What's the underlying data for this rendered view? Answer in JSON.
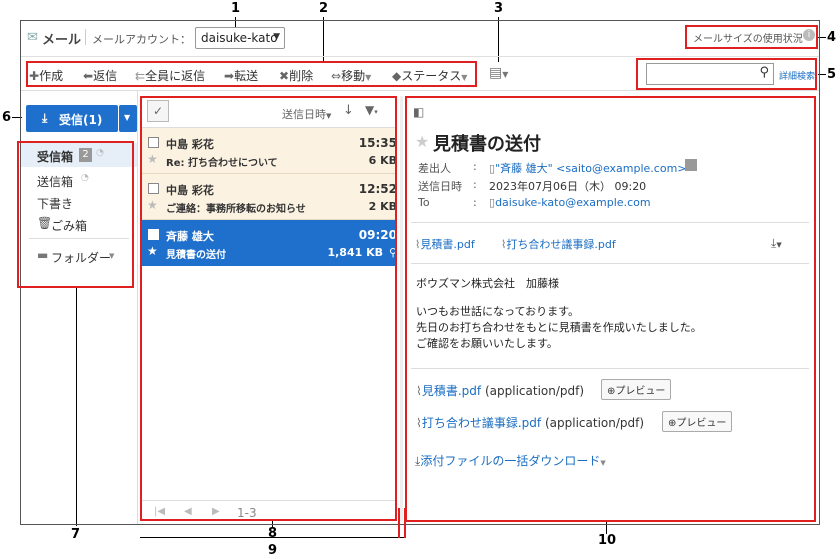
{
  "callouts": [
    "1",
    "2",
    "3",
    "4",
    "5",
    "6",
    "7",
    "8",
    "9",
    "10"
  ],
  "header": {
    "app_title": "メール",
    "account_label": "メールアカウント：",
    "account_value": "daisuke-kato",
    "mail_size_link": "メールサイズの使用状況"
  },
  "toolbar": {
    "compose": "作成",
    "reply": "返信",
    "reply_all": "全員に返信",
    "forward": "転送",
    "delete": "削除",
    "move": "移動",
    "status": "ステータス",
    "advanced_search": "詳細検索"
  },
  "receive_button": "受信(1)",
  "folders": {
    "inbox": "受信箱",
    "inbox_count": "2",
    "sent": "送信箱",
    "drafts": "下書き",
    "trash": "ごみ箱",
    "folder_menu": "フォルダー"
  },
  "list": {
    "sort_label": "送信日時",
    "pagination": "1-3",
    "rows": [
      {
        "sender": "中島 彩花",
        "subject": "Re: 打ち合わせについて",
        "time": "15:35",
        "size": "6 KB"
      },
      {
        "sender": "中島 彩花",
        "subject": "ご連絡：事務所移転のお知らせ",
        "time": "12:52",
        "size": "2 KB"
      },
      {
        "sender": "斉藤 雄大",
        "subject": "見積書の送付",
        "time": "09:20",
        "size": "1,841 KB"
      }
    ]
  },
  "message": {
    "subject": "見積書の送付",
    "from_label": "差出人",
    "from_value": "\"斉藤 雄大\" <saito@example.com>",
    "date_label": "送信日時",
    "date_value": "2023年07月06日（木） 09:20",
    "to_label": "To",
    "to_value": "daisuke-kato@example.com",
    "attach_top_1": "見積書.pdf",
    "attach_top_2": "打ち合わせ議事録.pdf",
    "body_line1": "ボウズマン株式会社　加藤様",
    "body_line2": "いつもお世話になっております。",
    "body_line3": "先日のお打ち合わせをもとに見積書を作成いたしました。",
    "body_line4": "ご確認をお願いいたします。",
    "attach1_name": "見積書.pdf",
    "attach1_type": "(application/pdf)",
    "attach2_name": "打ち合わせ議事録.pdf",
    "attach2_type": "(application/pdf)",
    "preview_label": "プレビュー",
    "bulk_download": "添付ファイルの一括ダウンロード"
  },
  "colors": {
    "accent": "#1a6dc2",
    "selected_row": "#1e70cc",
    "unread_row": "#fbf2e1",
    "callout": "#e02020"
  }
}
